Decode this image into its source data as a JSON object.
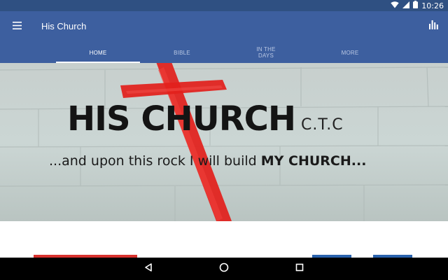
{
  "status_bar": {
    "time": "10:26",
    "icons": [
      "wifi-icon",
      "signal-icon",
      "battery-icon"
    ]
  },
  "app_bar": {
    "title": "His Church",
    "menu_icon": "hamburger-menu-icon",
    "action_icon": "bar-chart-icon"
  },
  "tabs": [
    {
      "label": "HOME",
      "active": true
    },
    {
      "label": "BIBLE",
      "active": false
    },
    {
      "label": "IN THE\nDAYS",
      "active": false
    },
    {
      "label": "MORE",
      "active": false
    }
  ],
  "banner": {
    "title": "HIS CHURCH",
    "suffix": "C.T.C",
    "tagline_lead": "...and upon this rock I will build ",
    "tagline_bold": "MY CHURCH...",
    "graphic": "red-cross"
  },
  "colors": {
    "status_bar": "#2f5082",
    "app_bar": "#3d5f9f",
    "cross": "#e2201c",
    "card_red": "#d7322e",
    "card_blue": "#2a62ad"
  },
  "nav_bar": {
    "icons": [
      "back-icon",
      "home-icon",
      "recents-icon"
    ]
  }
}
